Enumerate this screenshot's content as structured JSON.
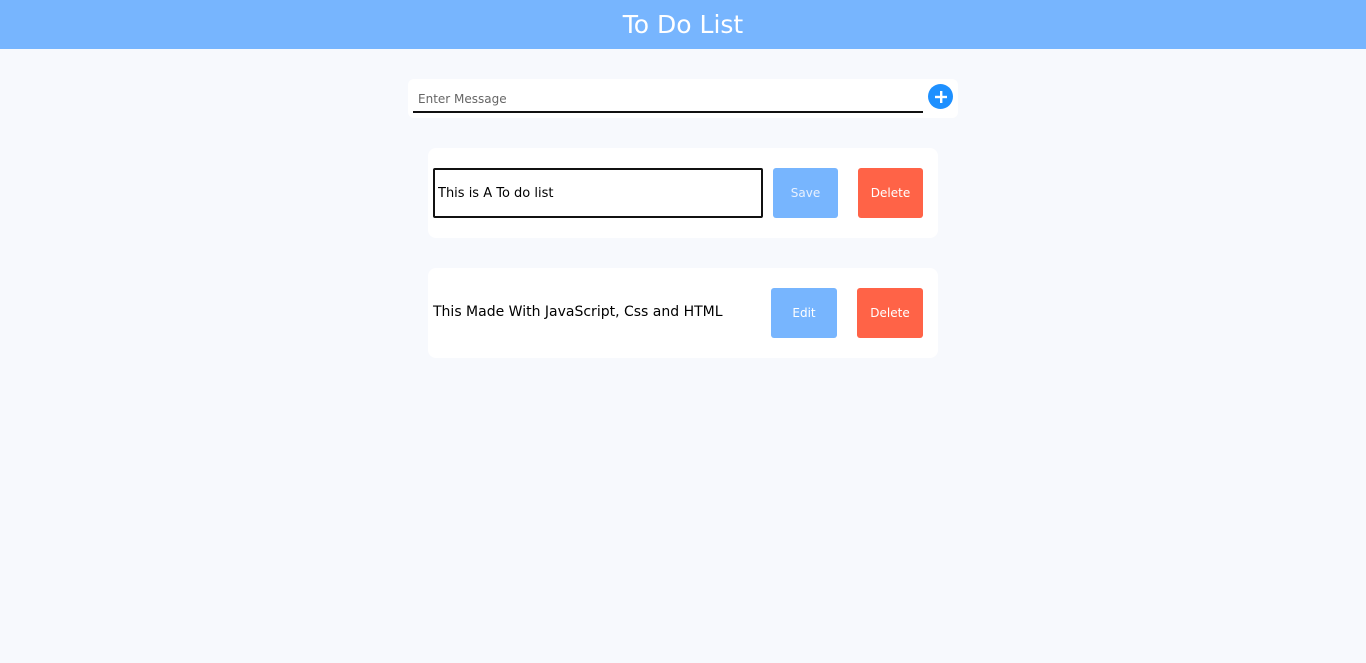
{
  "header": {
    "title": "To Do List"
  },
  "add_bar": {
    "placeholder": "Enter Message",
    "value": "",
    "add_icon": "plus-circle-icon"
  },
  "todos": [
    {
      "mode": "editing",
      "text": "This is A To do list",
      "primary_label": "Save",
      "delete_label": "Delete"
    },
    {
      "mode": "view",
      "text": "This Made With JavaScript, Css and HTML",
      "primary_label": "Edit",
      "delete_label": "Delete"
    }
  ],
  "colors": {
    "header_bg": "#77b5fe",
    "page_bg": "#f7f9fd",
    "primary_button": "#77b5fe",
    "delete_button": "#ff6347",
    "add_button": "#1e90ff"
  }
}
